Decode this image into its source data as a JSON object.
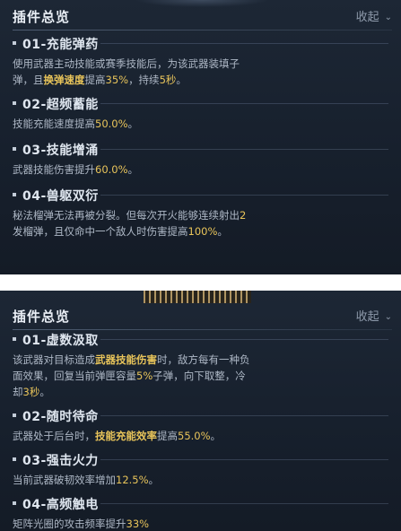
{
  "panels": [
    {
      "title": "插件总览",
      "collapse_label": "收起",
      "plugins": [
        {
          "title": "01-充能弹药",
          "desc_line1": "使用武器主动技能或赛季技能后，为该武器装填子",
          "desc_line2_a": "弹，且",
          "desc_line2_b": "换弹速度",
          "desc_line2_c": "提高",
          "desc_line2_d": "35%",
          "desc_line2_e": "，持续",
          "desc_line2_f": "5秒",
          "desc_line2_g": "。"
        },
        {
          "title": "02-超频蓄能",
          "desc_a": "技能充能速度提高",
          "desc_b": "50.0%",
          "desc_c": "。"
        },
        {
          "title": "03-技能增涌",
          "desc_a": "武器技能伤害提升",
          "desc_b": "60.0%",
          "desc_c": "。"
        },
        {
          "title": "04-兽躯双衍",
          "desc_line1_a": "秘法榴弹无法再被分裂。但每次开火能够连续射出",
          "desc_line1_b": "2",
          "desc_line2_a": "发榴弹，且仅命中一个敌人时伤害提高",
          "desc_line2_b": "100%",
          "desc_line2_c": "。"
        }
      ]
    },
    {
      "title": "插件总览",
      "collapse_label": "收起",
      "plugins": [
        {
          "title": "01-虚数汲取",
          "desc_line1_a": "该武器对目标造成",
          "desc_line1_b": "武器技能伤害",
          "desc_line1_c": "时，敌方每有一种负",
          "desc_line2_a": "面效果，回复当前弹匣容量",
          "desc_line2_b": "5%",
          "desc_line2_c": "子弹，向下取整，冷",
          "desc_line3_a": "却",
          "desc_line3_b": "3秒",
          "desc_line3_c": "。"
        },
        {
          "title": "02-随时待命",
          "desc_a": "武器处于后台时，",
          "desc_b": "技能充能效率",
          "desc_c": "提高",
          "desc_d": "55.0%",
          "desc_e": "。"
        },
        {
          "title": "03-强击火力",
          "desc_a": "当前武器破韧效率增加",
          "desc_b": "12.5%",
          "desc_c": "。"
        },
        {
          "title": "04-高频触电",
          "desc_a": "矩阵光圈的攻击频率提升",
          "desc_b": "33%"
        }
      ]
    }
  ],
  "colors": {
    "highlight": "#e8c45a",
    "panel_bg": "#1a2330",
    "title": "#e9eef5",
    "body_text": "#aeb8c6"
  },
  "icons": {
    "collapse": "chevron-down-icon",
    "bullet": "square-bullet-icon"
  }
}
